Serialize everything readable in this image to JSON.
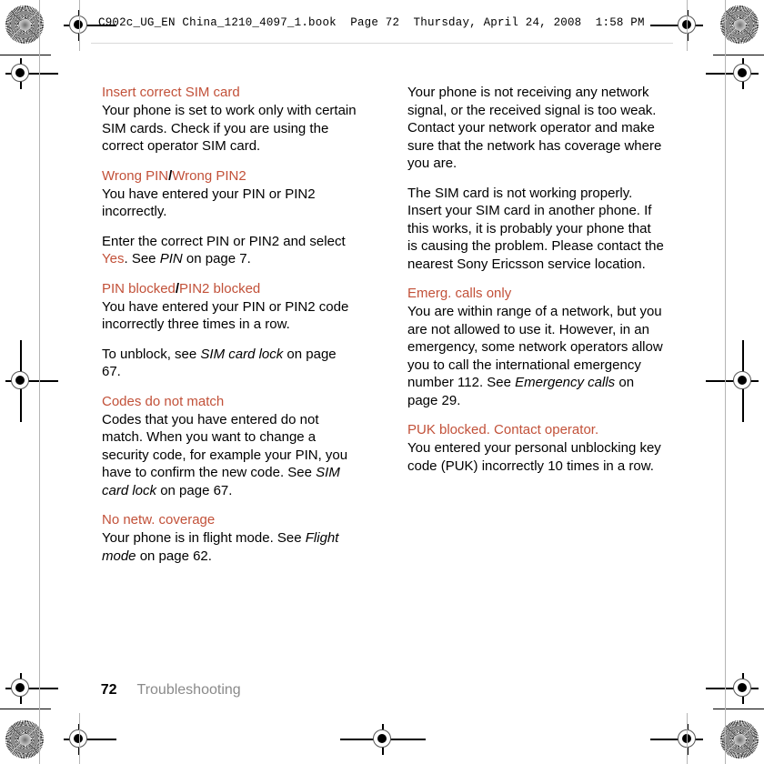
{
  "header": {
    "running_head": "C902c_UG_EN China_1210_4097_1.book  Page 72  Thursday, April 24, 2008  1:58 PM"
  },
  "colors": {
    "heading_accent": "#c25139",
    "body_text": "#000000",
    "footer_chapter": "#8a8a8a",
    "trim_line": "#b5b5b5"
  },
  "left_column": {
    "sections": [
      {
        "heading": "Insert correct SIM card",
        "heading_parts": [
          {
            "text": "Insert correct SIM card",
            "style": "accent"
          }
        ],
        "paragraphs": [
          "Your phone is set to work only with certain SIM cards. Check if you are using the correct operator SIM card."
        ]
      },
      {
        "heading": "Wrong PIN/Wrong PIN2",
        "heading_parts": [
          {
            "text": "Wrong PIN",
            "style": "accent"
          },
          {
            "text": "/",
            "style": "separator"
          },
          {
            "text": "Wrong PIN2",
            "style": "accent"
          }
        ],
        "paragraphs": [
          "You have entered your PIN or PIN2 incorrectly.",
          "Enter the correct PIN or PIN2 and select Yes. See PIN on page 7."
        ],
        "paragraph_2_runs": [
          {
            "text": "Enter the correct PIN or PIN2 and select ",
            "style": "plain"
          },
          {
            "text": "Yes",
            "style": "accent"
          },
          {
            "text": ". See ",
            "style": "plain"
          },
          {
            "text": "PIN",
            "style": "italic"
          },
          {
            "text": " on page 7.",
            "style": "plain"
          }
        ]
      },
      {
        "heading": "PIN blocked/PIN2 blocked",
        "heading_parts": [
          {
            "text": "PIN blocked",
            "style": "accent"
          },
          {
            "text": "/",
            "style": "separator"
          },
          {
            "text": "PIN2 blocked",
            "style": "accent"
          }
        ],
        "paragraphs": [
          "You have entered your PIN or PIN2 code incorrectly three times in a row.",
          "To unblock, see SIM card lock on page 67."
        ],
        "paragraph_2_runs": [
          {
            "text": "To unblock, see ",
            "style": "plain"
          },
          {
            "text": "SIM card lock",
            "style": "italic"
          },
          {
            "text": " on page 67.",
            "style": "plain"
          }
        ]
      },
      {
        "heading": "Codes do not match",
        "heading_parts": [
          {
            "text": "Codes do not match",
            "style": "accent"
          }
        ],
        "paragraphs": [
          "Codes that you have entered do not match. When you want to change a security code, for example your PIN, you have to confirm the new code. See SIM card lock on page 67."
        ],
        "paragraph_1_runs": [
          {
            "text": "Codes that you have entered do not match. When you want to change a security code, for example your PIN, you have to confirm the new code. See ",
            "style": "plain"
          },
          {
            "text": "SIM card lock",
            "style": "italic"
          },
          {
            "text": " on page 67.",
            "style": "plain"
          }
        ]
      },
      {
        "heading": "No netw. coverage",
        "heading_parts": [
          {
            "text": "No netw. coverage",
            "style": "accent"
          }
        ],
        "paragraphs": [
          "Your phone is in flight mode. See Flight mode on page 62."
        ],
        "paragraph_1_runs": [
          {
            "text": "Your phone is in flight mode. See ",
            "style": "plain"
          },
          {
            "text": "Flight mode",
            "style": "italic"
          },
          {
            "text": " on page 62.",
            "style": "plain"
          }
        ]
      }
    ]
  },
  "right_column": {
    "sections": [
      {
        "heading": null,
        "paragraphs": [
          "Your phone is not receiving any network signal, or the received signal is too weak. Contact your network operator and make sure that the network has coverage where you are.",
          "The SIM card is not working properly. Insert your SIM card in another phone. If this works, it is probably your phone that is causing the problem. Please contact the nearest Sony Ericsson service location."
        ]
      },
      {
        "heading": "Emerg. calls only",
        "heading_parts": [
          {
            "text": "Emerg. calls only",
            "style": "accent"
          }
        ],
        "paragraphs": [
          "You are within range of a network, but you are not allowed to use it. However, in an emergency, some network operators allow you to call the international emergency number 112. See Emergency calls on page 29."
        ],
        "paragraph_1_runs": [
          {
            "text": "You are within range of a network, but you are not allowed to use it. However, in an emergency, some network operators allow you to call the international emergency number 112. See ",
            "style": "plain"
          },
          {
            "text": "Emergency calls",
            "style": "italic"
          },
          {
            "text": " on page 29.",
            "style": "plain"
          }
        ]
      },
      {
        "heading": "PUK blocked. Contact operator.",
        "heading_parts": [
          {
            "text": "PUK blocked. Contact operator.",
            "style": "accent"
          }
        ],
        "paragraphs": [
          "You entered your personal unblocking key code (PUK) incorrectly 10 times in a row."
        ]
      }
    ]
  },
  "footer": {
    "page_number": "72",
    "chapter_title": "Troubleshooting"
  },
  "print_marks": {
    "starburst_label": "radial-resolution-target",
    "registration_label": "registration-crosshair"
  }
}
